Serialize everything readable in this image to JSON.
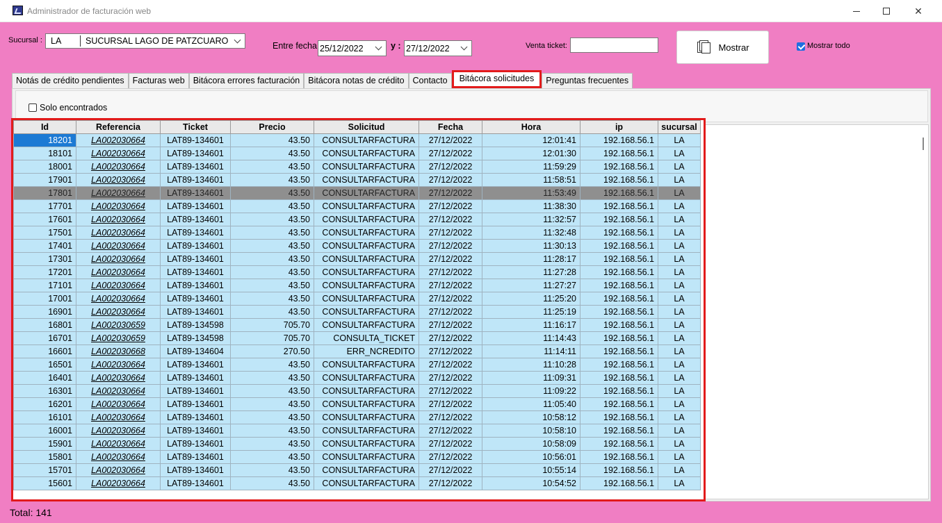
{
  "window": {
    "title": "Administrador de facturación web"
  },
  "toolbar": {
    "sucursal_label": "Sucursal :",
    "sucursal_code": "LA",
    "sucursal_name": "SUCURSAL LAGO DE PATZCUARO",
    "entre_fecha_label": "Entre fecha",
    "fecha_inicio": "25/12/2022",
    "y_label": "y :",
    "fecha_fin": "27/12/2022",
    "venta_ticket_label": "Venta ticket:",
    "venta_ticket_value": "",
    "mostrar_label": "Mostrar",
    "mostrar_todo_label": "Mostrar todo",
    "mostrar_todo_checked": true
  },
  "tabs": [
    {
      "label": "Notás de crédito pendientes",
      "active": false
    },
    {
      "label": "Facturas web",
      "active": false
    },
    {
      "label": "Bitácora errores facturación",
      "active": false
    },
    {
      "label": "Bitácora notas de crédito",
      "active": false
    },
    {
      "label": "Contacto",
      "active": false
    },
    {
      "label": "Bitácora solicitudes",
      "active": true
    },
    {
      "label": "Preguntas frecuentes",
      "active": false
    }
  ],
  "filter": {
    "solo_encontrados_label": "Solo encontrados",
    "checked": false
  },
  "grid": {
    "columns": [
      "Id",
      "Referencia",
      "Ticket",
      "Precio",
      "Solicitud",
      "Fecha",
      "Hora",
      "ip",
      "sucursal"
    ],
    "selected_row": 4,
    "rows": [
      [
        "18201",
        "LA002030664",
        "LAT89-134601",
        "43.50",
        "CONSULTARFACTURA",
        "27/12/2022",
        "12:01:41",
        "192.168.56.1",
        "LA"
      ],
      [
        "18101",
        "LA002030664",
        "LAT89-134601",
        "43.50",
        "CONSULTARFACTURA",
        "27/12/2022",
        "12:01:30",
        "192.168.56.1",
        "LA"
      ],
      [
        "18001",
        "LA002030664",
        "LAT89-134601",
        "43.50",
        "CONSULTARFACTURA",
        "27/12/2022",
        "11:59:29",
        "192.168.56.1",
        "LA"
      ],
      [
        "17901",
        "LA002030664",
        "LAT89-134601",
        "43.50",
        "CONSULTARFACTURA",
        "27/12/2022",
        "11:58:51",
        "192.168.56.1",
        "LA"
      ],
      [
        "17801",
        "LA002030664",
        "LAT89-134601",
        "43.50",
        "CONSULTARFACTURA",
        "27/12/2022",
        "11:53:49",
        "192.168.56.1",
        "LA"
      ],
      [
        "17701",
        "LA002030664",
        "LAT89-134601",
        "43.50",
        "CONSULTARFACTURA",
        "27/12/2022",
        "11:38:30",
        "192.168.56.1",
        "LA"
      ],
      [
        "17601",
        "LA002030664",
        "LAT89-134601",
        "43.50",
        "CONSULTARFACTURA",
        "27/12/2022",
        "11:32:57",
        "192.168.56.1",
        "LA"
      ],
      [
        "17501",
        "LA002030664",
        "LAT89-134601",
        "43.50",
        "CONSULTARFACTURA",
        "27/12/2022",
        "11:32:48",
        "192.168.56.1",
        "LA"
      ],
      [
        "17401",
        "LA002030664",
        "LAT89-134601",
        "43.50",
        "CONSULTARFACTURA",
        "27/12/2022",
        "11:30:13",
        "192.168.56.1",
        "LA"
      ],
      [
        "17301",
        "LA002030664",
        "LAT89-134601",
        "43.50",
        "CONSULTARFACTURA",
        "27/12/2022",
        "11:28:17",
        "192.168.56.1",
        "LA"
      ],
      [
        "17201",
        "LA002030664",
        "LAT89-134601",
        "43.50",
        "CONSULTARFACTURA",
        "27/12/2022",
        "11:27:28",
        "192.168.56.1",
        "LA"
      ],
      [
        "17101",
        "LA002030664",
        "LAT89-134601",
        "43.50",
        "CONSULTARFACTURA",
        "27/12/2022",
        "11:27:27",
        "192.168.56.1",
        "LA"
      ],
      [
        "17001",
        "LA002030664",
        "LAT89-134601",
        "43.50",
        "CONSULTARFACTURA",
        "27/12/2022",
        "11:25:20",
        "192.168.56.1",
        "LA"
      ],
      [
        "16901",
        "LA002030664",
        "LAT89-134601",
        "43.50",
        "CONSULTARFACTURA",
        "27/12/2022",
        "11:25:19",
        "192.168.56.1",
        "LA"
      ],
      [
        "16801",
        "LA002030659",
        "LAT89-134598",
        "705.70",
        "CONSULTARFACTURA",
        "27/12/2022",
        "11:16:17",
        "192.168.56.1",
        "LA"
      ],
      [
        "16701",
        "LA002030659",
        "LAT89-134598",
        "705.70",
        "CONSULTA_TICKET",
        "27/12/2022",
        "11:14:43",
        "192.168.56.1",
        "LA"
      ],
      [
        "16601",
        "LA002030668",
        "LAT89-134604",
        "270.50",
        "ERR_NCREDITO",
        "27/12/2022",
        "11:14:11",
        "192.168.56.1",
        "LA"
      ],
      [
        "16501",
        "LA002030664",
        "LAT89-134601",
        "43.50",
        "CONSULTARFACTURA",
        "27/12/2022",
        "11:10:28",
        "192.168.56.1",
        "LA"
      ],
      [
        "16401",
        "LA002030664",
        "LAT89-134601",
        "43.50",
        "CONSULTARFACTURA",
        "27/12/2022",
        "11:09:31",
        "192.168.56.1",
        "LA"
      ],
      [
        "16301",
        "LA002030664",
        "LAT89-134601",
        "43.50",
        "CONSULTARFACTURA",
        "27/12/2022",
        "11:09:22",
        "192.168.56.1",
        "LA"
      ],
      [
        "16201",
        "LA002030664",
        "LAT89-134601",
        "43.50",
        "CONSULTARFACTURA",
        "27/12/2022",
        "11:05:40",
        "192.168.56.1",
        "LA"
      ],
      [
        "16101",
        "LA002030664",
        "LAT89-134601",
        "43.50",
        "CONSULTARFACTURA",
        "27/12/2022",
        "10:58:12",
        "192.168.56.1",
        "LA"
      ],
      [
        "16001",
        "LA002030664",
        "LAT89-134601",
        "43.50",
        "CONSULTARFACTURA",
        "27/12/2022",
        "10:58:10",
        "192.168.56.1",
        "LA"
      ],
      [
        "15901",
        "LA002030664",
        "LAT89-134601",
        "43.50",
        "CONSULTARFACTURA",
        "27/12/2022",
        "10:58:09",
        "192.168.56.1",
        "LA"
      ],
      [
        "15801",
        "LA002030664",
        "LAT89-134601",
        "43.50",
        "CONSULTARFACTURA",
        "27/12/2022",
        "10:56:01",
        "192.168.56.1",
        "LA"
      ],
      [
        "15701",
        "LA002030664",
        "LAT89-134601",
        "43.50",
        "CONSULTARFACTURA",
        "27/12/2022",
        "10:55:14",
        "192.168.56.1",
        "LA"
      ],
      [
        "15601",
        "LA002030664",
        "LAT89-134601",
        "43.50",
        "CONSULTARFACTURA",
        "27/12/2022",
        "10:54:52",
        "192.168.56.1",
        "LA"
      ]
    ]
  },
  "status": {
    "total_label": "Total: 141"
  },
  "colors": {
    "accent": "#f07ec3",
    "highlight": "#e21b1b",
    "row": "#bfe6f8",
    "selected": "#8f8f8f"
  }
}
